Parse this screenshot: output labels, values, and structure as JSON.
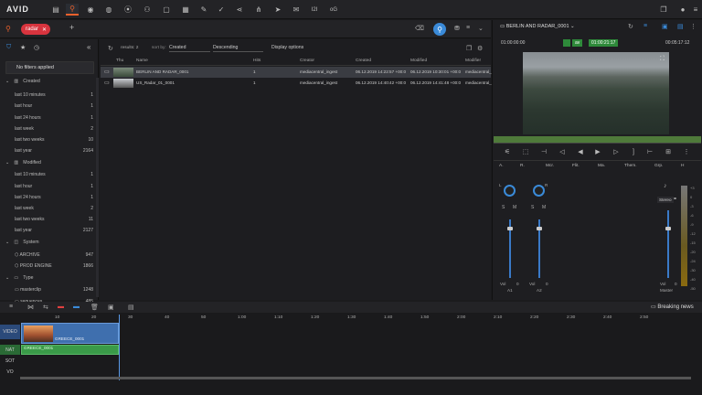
{
  "app": {
    "logo": "AVID"
  },
  "topbar": {
    "icons": [
      "folder-icon",
      "search-icon",
      "eye-icon",
      "globe-icon",
      "record-icon",
      "users-icon",
      "chat-icon",
      "grid-icon",
      "edit-icon",
      "check-icon",
      "share-icon",
      "nodes-icon",
      "send-icon",
      "mail-icon",
      "i2-icon",
      "og-icon"
    ],
    "i2": "I2I",
    "og": "oG",
    "right_icons": [
      "copy-icon",
      "user-icon",
      "menu-icon"
    ]
  },
  "search": {
    "chip": "radar"
  },
  "filters": {
    "no_filters": "No filters applied",
    "groups": [
      {
        "name": "Created",
        "rows": [
          [
            "last 10 minutes",
            "1"
          ],
          [
            "last hour",
            "1"
          ],
          [
            "last 24 hours",
            "1"
          ],
          [
            "last week",
            "2"
          ],
          [
            "last two weeks",
            "10"
          ],
          [
            "last year",
            "2164"
          ]
        ]
      },
      {
        "name": "Modified",
        "rows": [
          [
            "last 10 minutes",
            "1"
          ],
          [
            "last hour",
            "1"
          ],
          [
            "last 24 hours",
            "1"
          ],
          [
            "last week",
            "2"
          ],
          [
            "last two weeks",
            "11"
          ],
          [
            "last year",
            "2127"
          ]
        ]
      },
      {
        "name": "System",
        "rows": [
          [
            "ARCHIVE",
            "947"
          ],
          [
            "PROD ENGINE",
            "1866"
          ]
        ]
      },
      {
        "name": "Type",
        "rows": [
          [
            "masterclip",
            "1248"
          ],
          [
            "sequences",
            "485"
          ]
        ]
      }
    ]
  },
  "browser": {
    "results": "results: 2",
    "sort_by": "sort by:",
    "sort_field": "Created",
    "sort_dir": "Descending",
    "display_options": "Display options",
    "columns": [
      "Thu",
      "Name",
      "Hits",
      "Creator",
      "Created",
      "Modified",
      "Modifier"
    ],
    "rows": [
      {
        "name": "BERLIN AND RADAR_0001",
        "hits": "1",
        "creator": "mediacentral_ingest",
        "created": "06.12.2019 14:22:57 +00:0",
        "modified": "06.12.2019 10:30:01 +00:0",
        "modifier": "mediacentral_"
      },
      {
        "name": "US_Radar_01_0001",
        "hits": "1",
        "creator": "mediacentral_ingest",
        "created": "06.12.2019 14:40:42 +00:0",
        "modified": "06.12.2019 14:41:48 +00:0",
        "modifier": "mediacentral_"
      }
    ]
  },
  "player": {
    "title": "BERLIN AND RADAR_0001",
    "tc_left": "01:00:00:00",
    "tc_mid": "01:00:21:17",
    "tc_right": "00:05:17:12",
    "mode": "av"
  },
  "audio": {
    "labels": [
      "A.",
      "R.",
      "Mcr.",
      "Flit.",
      "Ma.",
      "Them.",
      "Grp.",
      "H"
    ],
    "ch1": {
      "l": "L",
      "r": "R",
      "vol": "Vol",
      "val": "0",
      "name": "A1"
    },
    "ch2": {
      "l": "L",
      "r": "R",
      "vol": "Vol",
      "val": "0",
      "name": "A2"
    },
    "master": {
      "stereo": "Stereo",
      "vol": "Vol",
      "val": "0",
      "name": "Master"
    },
    "scale": [
      "+3",
      "0",
      "-3",
      "-6",
      "-9",
      "-12",
      "-15",
      "-20",
      "-24",
      "-30",
      "-40",
      "-50"
    ]
  },
  "timeline": {
    "breaking_news": "Breaking news",
    "ruler": [
      "10",
      "20",
      "30",
      "40",
      "50",
      "1:00",
      "1:10",
      "1:20",
      "1:30",
      "1:40",
      "1:50",
      "2:00",
      "2:10",
      "2:20",
      "2:30",
      "2:40",
      "2:50"
    ],
    "tracks": [
      "VIDEO",
      "NAT",
      "SOT",
      "VO"
    ],
    "video_clip": "GREECE_0001",
    "audio_clip": "GREECE_0001"
  }
}
